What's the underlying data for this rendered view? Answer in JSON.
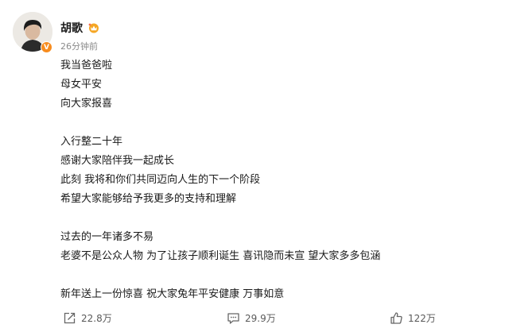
{
  "post": {
    "author": "胡歌",
    "time": "26分钟前",
    "text": [
      "我当爸爸啦",
      "母女平安",
      "向大家报喜",
      "",
      "入行整二十年",
      "感谢大家陪伴我一起成长",
      "此刻 我将和你们共同迈向人生的下一个阶段",
      "希望大家能够给予我更多的支持和理解",
      "",
      "过去的一年诸多不易",
      "老婆不是公众人物 为了让孩子顺利诞生 喜讯隐而未宣 望大家多多包涵",
      "",
      "新年送上一份惊喜 祝大家兔年平安健康 万事如意"
    ]
  },
  "actions": {
    "repost_count": "22.8万",
    "comment_count": "29.9万",
    "like_count": "122万"
  },
  "colors": {
    "verified_badge": "#f78c1e",
    "member_icon": "#f5a623",
    "secondary_text": "#8a8a8a"
  }
}
